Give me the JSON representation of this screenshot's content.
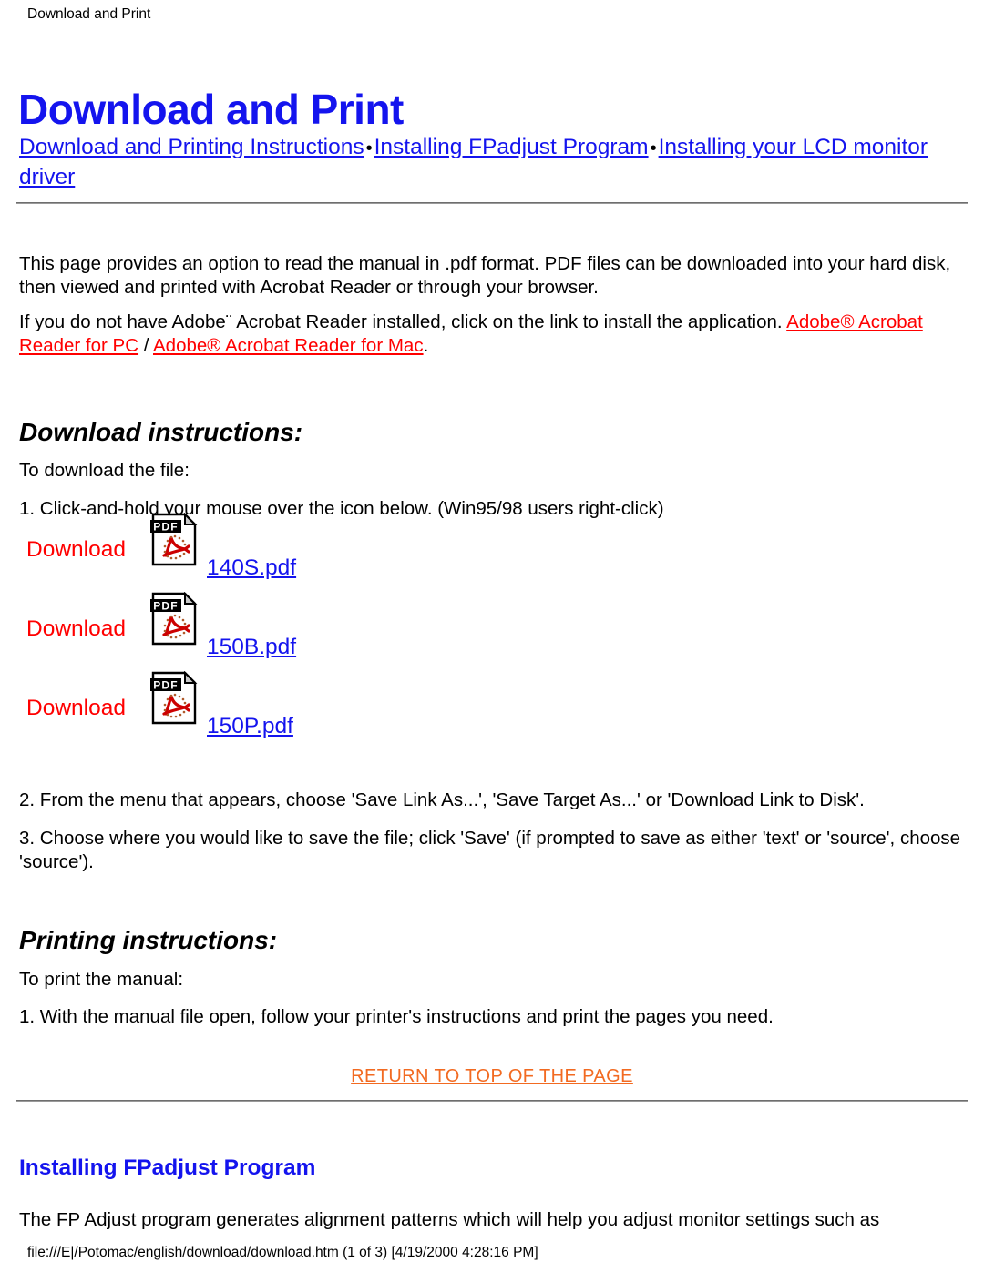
{
  "document": {
    "running_header": "Download and Print",
    "title": "Download and Print",
    "footer": "file:///E|/Potomac/english/download/download.htm (1 of 3) [4/19/2000 4:28:16 PM]"
  },
  "colors": {
    "heading_blue": "#1414EE",
    "link_blue": "#1414EE",
    "link_red": "#FF0000",
    "return_orange": "#F26A21",
    "text_black": "#000000",
    "rule_gray": "#9A9A9A",
    "background": "#FFFFFF"
  },
  "nav": {
    "links": [
      {
        "label": "Download and Printing Instructions"
      },
      {
        "label": "Installing FPadjust Program"
      },
      {
        "label": "Installing your LCD monitor driver"
      }
    ],
    "separator": "•"
  },
  "intro": {
    "paragraph": "This page provides an option to read the manual in .pdf format. PDF files can be downloaded into your hard disk, then viewed and printed with Acrobat Reader or through your browser."
  },
  "adobe": {
    "text_before": "If you do not have Adobe¨ Acrobat Reader installed, click on the link to install the application. ",
    "link_pc": "Adobe® Acrobat Reader for PC",
    "divider": " / ",
    "link_mac": "Adobe® Acrobat Reader for Mac",
    "text_after": "."
  },
  "download_section": {
    "heading": "Download instructions:",
    "lead": "To download the file:",
    "step1": "1. Click-and-hold your mouse over the icon below. (Win95/98 users right-click)",
    "rows": [
      {
        "label": "Download",
        "icon": "pdf-file-icon",
        "file": "140S.pdf"
      },
      {
        "label": "Download",
        "icon": "pdf-file-icon",
        "file": "150B.pdf"
      },
      {
        "label": "Download",
        "icon": "pdf-file-icon",
        "file": "150P.pdf"
      }
    ],
    "step2": "2. From the menu that appears, choose 'Save Link As...', 'Save Target As...' or 'Download Link to Disk'.",
    "step3": "3. Choose where you would like to save the file; click 'Save' (if prompted to save as either 'text' or 'source', choose 'source')."
  },
  "print_section": {
    "heading": "Printing instructions:",
    "lead": "To print the manual:",
    "step1": "1. With the manual file open, follow your printer's instructions and print the pages you need."
  },
  "return_to_top": {
    "label": "RETURN TO TOP OF THE PAGE"
  },
  "fpadjust_section": {
    "heading": "Installing FPadjust Program",
    "paragraph": "The FP Adjust program generates alignment patterns which will help you adjust monitor settings such as"
  },
  "pdf_icon": {
    "badge_text": "PDF"
  }
}
